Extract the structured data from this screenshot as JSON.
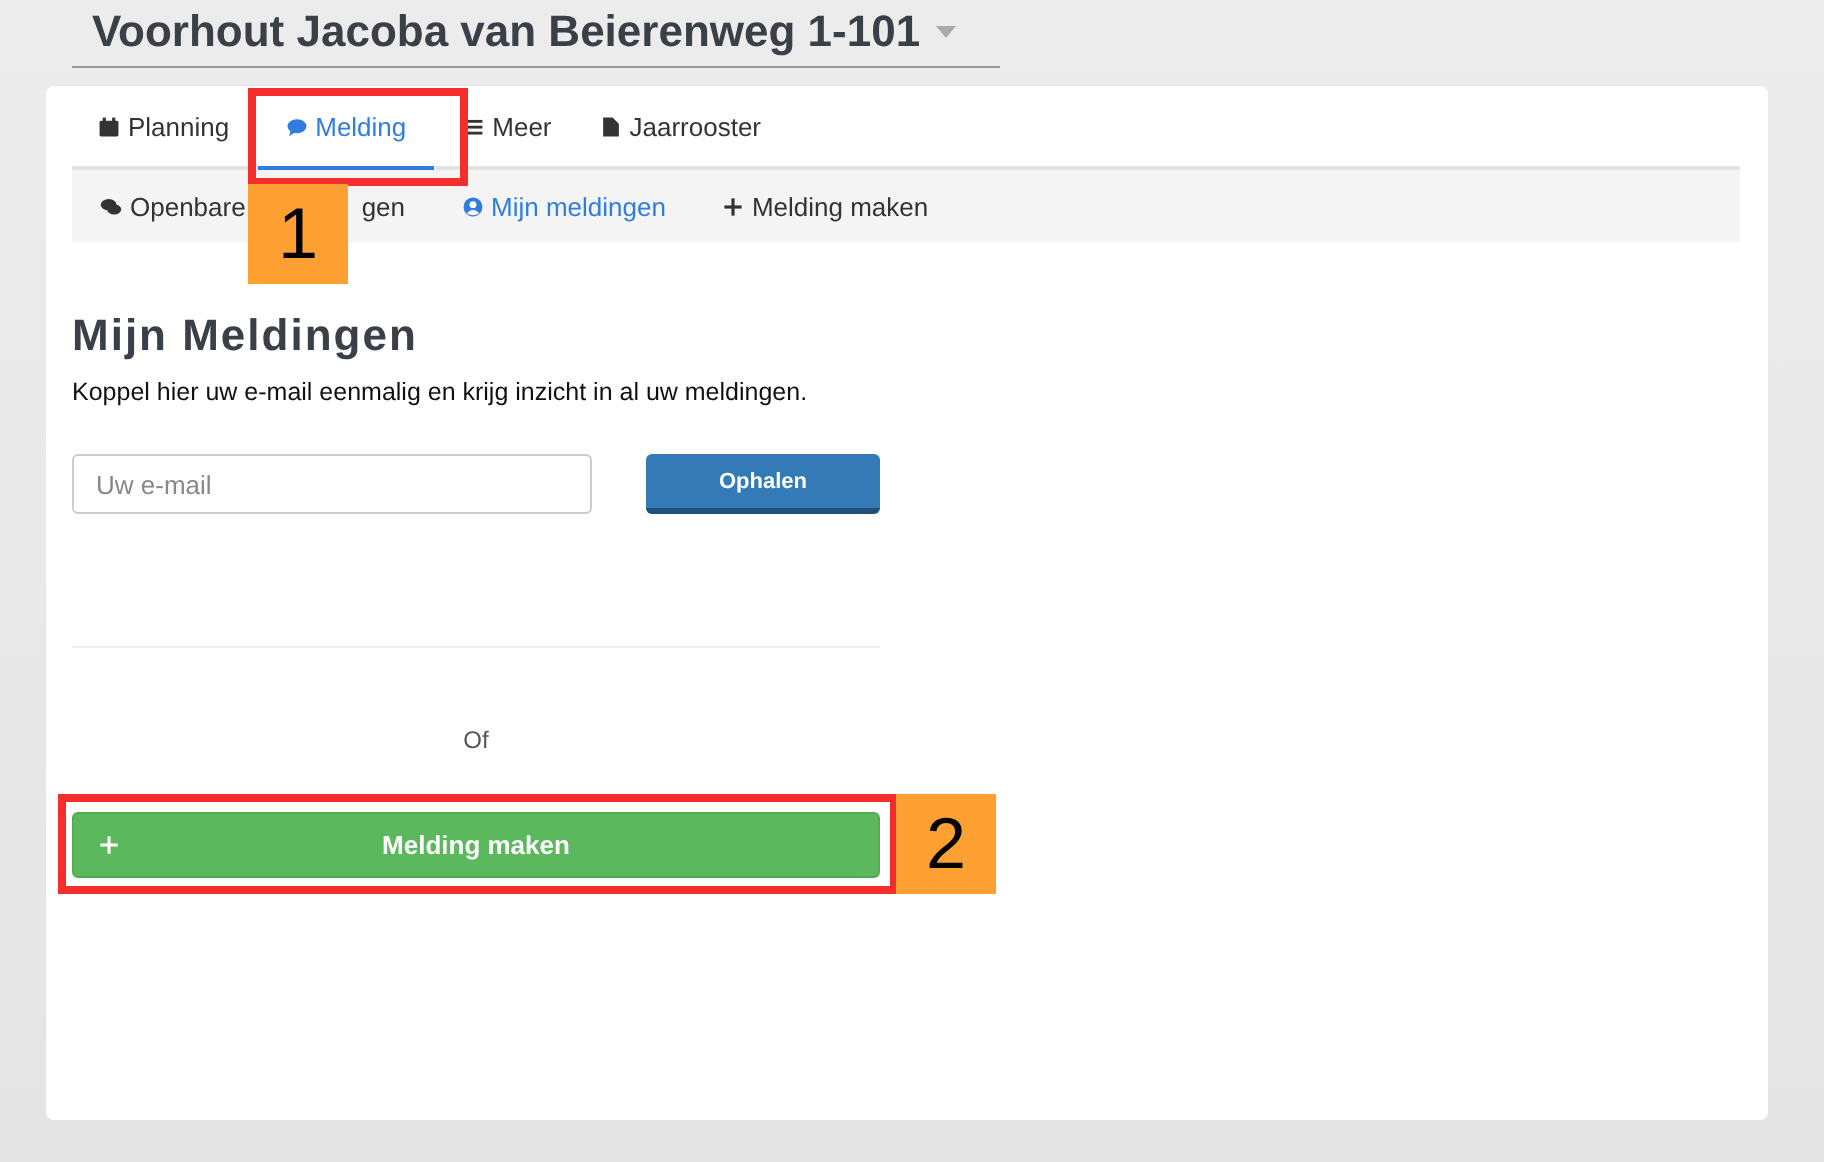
{
  "header": {
    "title": "Voorhout Jacoba van Beierenweg 1-101"
  },
  "tabs": [
    {
      "label": "Planning",
      "selected": false
    },
    {
      "label": "Melding",
      "selected": true
    },
    {
      "label": "Meer",
      "selected": false
    },
    {
      "label": "Jaarrooster",
      "selected": false
    }
  ],
  "subtabs": [
    {
      "label": "Openbare",
      "label_end": "gen",
      "selected": false
    },
    {
      "label": "Mijn meldingen",
      "selected": true
    },
    {
      "label": "Melding maken",
      "selected": false
    }
  ],
  "content": {
    "heading": "Mijn Meldingen",
    "description": "Koppel hier uw e-mail eenmalig en krijg inzicht in al uw meldingen.",
    "email_field": {
      "placeholder": "Uw e-mail"
    },
    "fetch_button": "Ophalen",
    "separator": "Of",
    "create_button": "Melding maken"
  },
  "callouts": [
    {
      "label": "1"
    },
    {
      "label": "2"
    }
  ]
}
